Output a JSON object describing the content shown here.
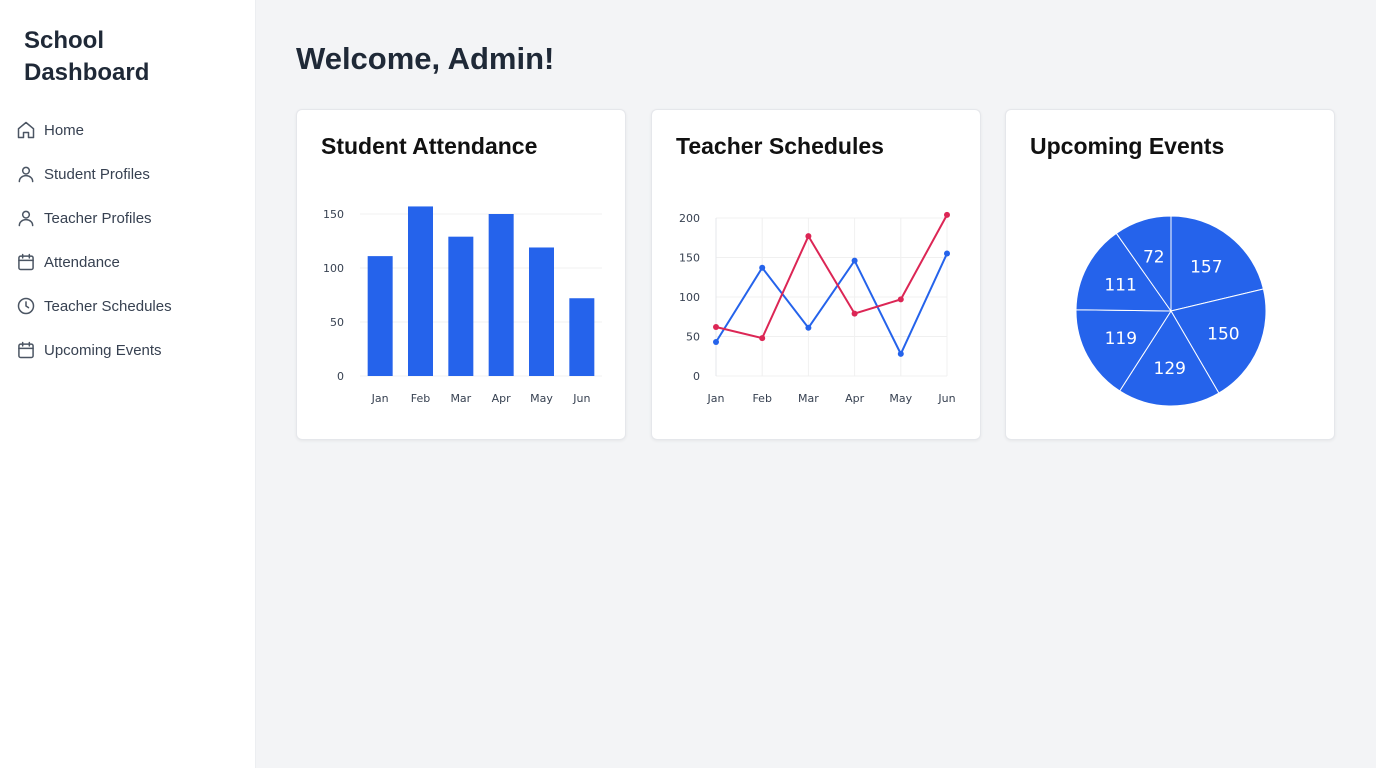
{
  "sidebar": {
    "brand": "School Dashboard",
    "items": [
      {
        "label": "Home",
        "icon": "home-icon"
      },
      {
        "label": "Student Profiles",
        "icon": "user-icon"
      },
      {
        "label": "Teacher Profiles",
        "icon": "user-icon"
      },
      {
        "label": "Attendance",
        "icon": "calendar-icon"
      },
      {
        "label": "Teacher Schedules",
        "icon": "clock-icon"
      },
      {
        "label": "Upcoming Events",
        "icon": "calendar-icon"
      }
    ]
  },
  "main": {
    "title": "Welcome, Admin!",
    "cards": [
      {
        "title": "Student Attendance"
      },
      {
        "title": "Teacher Schedules"
      },
      {
        "title": "Upcoming Events"
      }
    ]
  },
  "colors": {
    "accent": "#2563eb",
    "series_red": "#dc2655",
    "background": "#f3f4f6"
  },
  "chart_data": [
    {
      "type": "bar",
      "categories": [
        "Jan",
        "Feb",
        "Mar",
        "Apr",
        "May",
        "Jun"
      ],
      "values": [
        111,
        157,
        129,
        150,
        119,
        72
      ],
      "yticks": [
        0,
        50,
        100,
        150
      ],
      "ylim": [
        0,
        150
      ],
      "grid": true
    },
    {
      "type": "line",
      "categories": [
        "Jan",
        "Feb",
        "Mar",
        "Apr",
        "May",
        "Jun"
      ],
      "series": [
        {
          "color": "#2563eb",
          "values": [
            43,
            137,
            61,
            146,
            28,
            155
          ]
        },
        {
          "color": "#dc2655",
          "values": [
            62,
            48,
            177,
            79,
            97,
            204
          ]
        }
      ],
      "yticks": [
        0,
        50,
        100,
        150,
        200
      ],
      "ylim": [
        0,
        200
      ],
      "grid": true
    },
    {
      "type": "pie",
      "values": [
        157,
        150,
        129,
        119,
        111,
        72
      ],
      "color": "#2563eb"
    }
  ]
}
